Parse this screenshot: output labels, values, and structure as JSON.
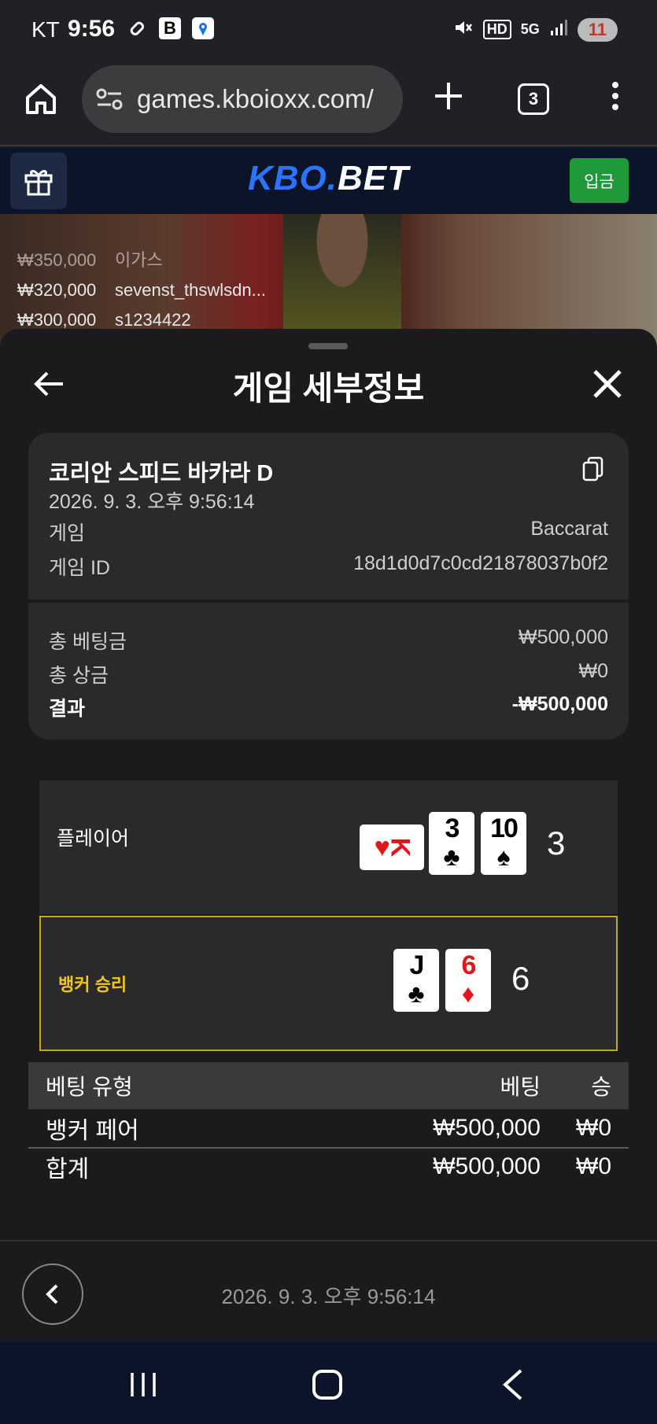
{
  "status_bar": {
    "carrier": "KT",
    "time": "9:56",
    "hd_label": "HD",
    "network": "5G",
    "battery": "11"
  },
  "browser": {
    "url": "games.kboioxx.com/",
    "tab_count": "3"
  },
  "site": {
    "logo_part1": "KBO.",
    "logo_part2": "BET",
    "deposit_label": "입금"
  },
  "winners": [
    {
      "amount": "₩350,000",
      "name": "이가스"
    },
    {
      "amount": "₩320,000",
      "name": "sevenst_thswlsdn..."
    },
    {
      "amount": "₩300,000",
      "name": "s1234422"
    }
  ],
  "sheet": {
    "title": "게임 세부정보",
    "game_name": "코리안 스피드 바카라 D",
    "datetime": "2026. 9. 3. 오후 9:56:14",
    "game_label": "게임",
    "game_value": "Baccarat",
    "game_id_label": "게임 ID",
    "game_id_value": "18d1d0d7c0cd21878037b0f2",
    "total_bet_label": "총 베팅금",
    "total_bet_value": "₩500,000",
    "total_win_label": "총 상금",
    "total_win_value": "₩0",
    "result_label": "결과",
    "result_value": "-₩500,000"
  },
  "hands": {
    "player": {
      "label": "플레이어",
      "cards": [
        {
          "rank": "K",
          "suit": "♥",
          "color": "red",
          "sideways": true
        },
        {
          "rank": "3",
          "suit": "♣",
          "color": "black"
        },
        {
          "rank": "10",
          "suit": "♠",
          "color": "black"
        }
      ],
      "score": "3"
    },
    "banker": {
      "label": "뱅커 승리",
      "cards": [
        {
          "rank": "J",
          "suit": "♣",
          "color": "black"
        },
        {
          "rank": "6",
          "suit": "♦",
          "color": "red"
        }
      ],
      "score": "6"
    }
  },
  "bets": {
    "headers": {
      "type": "베팅 유형",
      "bet": "베팅",
      "win": "승"
    },
    "rows": [
      {
        "type": "뱅커 페어",
        "bet": "₩500,000",
        "win": "₩0"
      }
    ],
    "total": {
      "type": "합계",
      "bet": "₩500,000",
      "win": "₩0"
    }
  },
  "footer": {
    "datetime": "2026. 9. 3. 오후 9:56:14"
  },
  "colors": {
    "accent_blue": "#2a74ff",
    "deposit_green": "#1f9a3a",
    "winner_highlight": "#f3c814",
    "card_red": "#e0161b"
  }
}
